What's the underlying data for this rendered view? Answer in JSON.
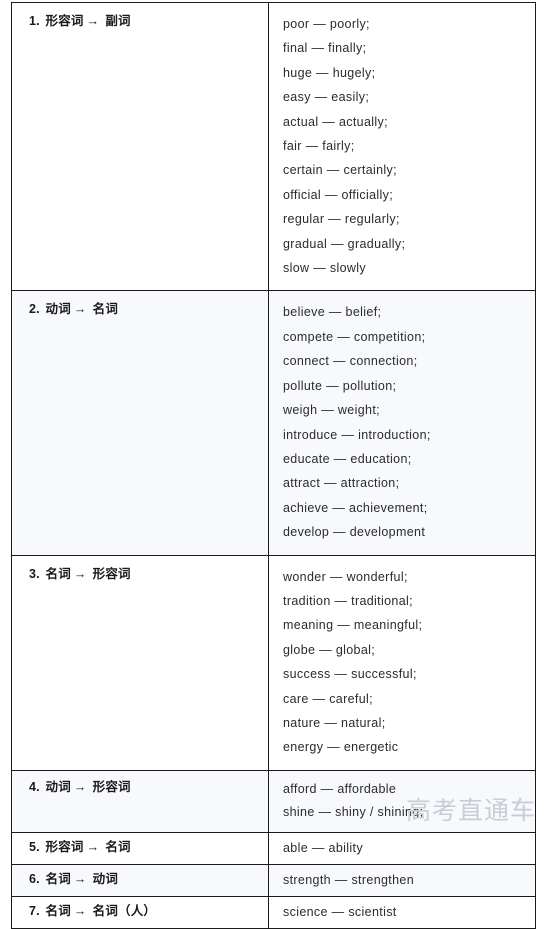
{
  "watermark": "高考直通车",
  "table": {
    "sections": [
      {
        "number": "1.",
        "from": "形容词",
        "arrow": "→",
        "to": "副词",
        "tinted": false,
        "pairs": [
          "poor — poorly;",
          "final — finally;",
          "huge — hugely;",
          "easy — easily;",
          "actual — actually;",
          "fair — fairly;",
          "certain — certainly;",
          "official — officially;",
          "regular — regularly;",
          "gradual — gradually;",
          "slow — slowly"
        ]
      },
      {
        "number": "2.",
        "from": "动词",
        "arrow": "→",
        "to": "名词",
        "tinted": true,
        "pairs": [
          "believe — belief;",
          "compete — competition;",
          "connect — connection;",
          "pollute — pollution;",
          "weigh — weight;",
          "introduce — introduction;",
          "educate — education;",
          "attract — attraction;",
          "achieve — achievement;",
          "develop — development"
        ]
      },
      {
        "number": "3.",
        "from": "名词",
        "arrow": "→",
        "to": "形容词",
        "tinted": false,
        "pairs": [
          "wonder — wonderful;",
          "tradition — traditional;",
          "meaning — meaningful;",
          "globe — global;",
          "success — successful;",
          "care — careful;",
          "nature — natural;",
          "energy — energetic"
        ]
      },
      {
        "number": "4.",
        "from": "动词",
        "arrow": "→",
        "to": "形容词",
        "tinted": true,
        "pairs": [
          "afford — affordable",
          "shine — shiny / shining;"
        ]
      },
      {
        "number": "5.",
        "from": "形容词",
        "arrow": "→",
        "to": "名词",
        "tinted": false,
        "pairs": [
          "able — ability"
        ]
      },
      {
        "number": "6.",
        "from": "名词",
        "arrow": "→",
        "to": "动词",
        "tinted": true,
        "pairs": [
          "strength — strengthen"
        ]
      },
      {
        "number": "7.",
        "from": "名词",
        "arrow": "→",
        "to": "名词（人）",
        "tinted": false,
        "pairs": [
          "science — scientist"
        ]
      }
    ]
  }
}
